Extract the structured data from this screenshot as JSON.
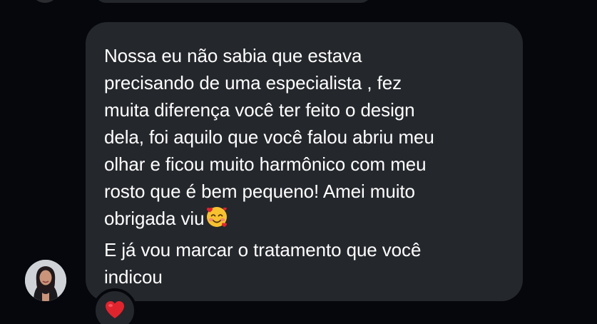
{
  "message": {
    "lines": [
      "Nossa eu não sabia que estava",
      "precisando de uma especialista , fez",
      "muita diferença você ter feito o design",
      "dela, foi aquilo que você falou abriu meu",
      "olhar e ficou muito harmônico com meu",
      "rosto que é bem pequeno! Amei muito",
      "obrigada viu",
      "E já vou marcar o tratamento que você",
      "indicou"
    ],
    "inline_emoji": "smiling-face-with-hearts-icon"
  },
  "reaction": {
    "icon": "red-heart-icon",
    "color": "#e0242e"
  },
  "colors": {
    "background": "#05070c",
    "bubble": "#24272c",
    "text": "#ffffff"
  }
}
